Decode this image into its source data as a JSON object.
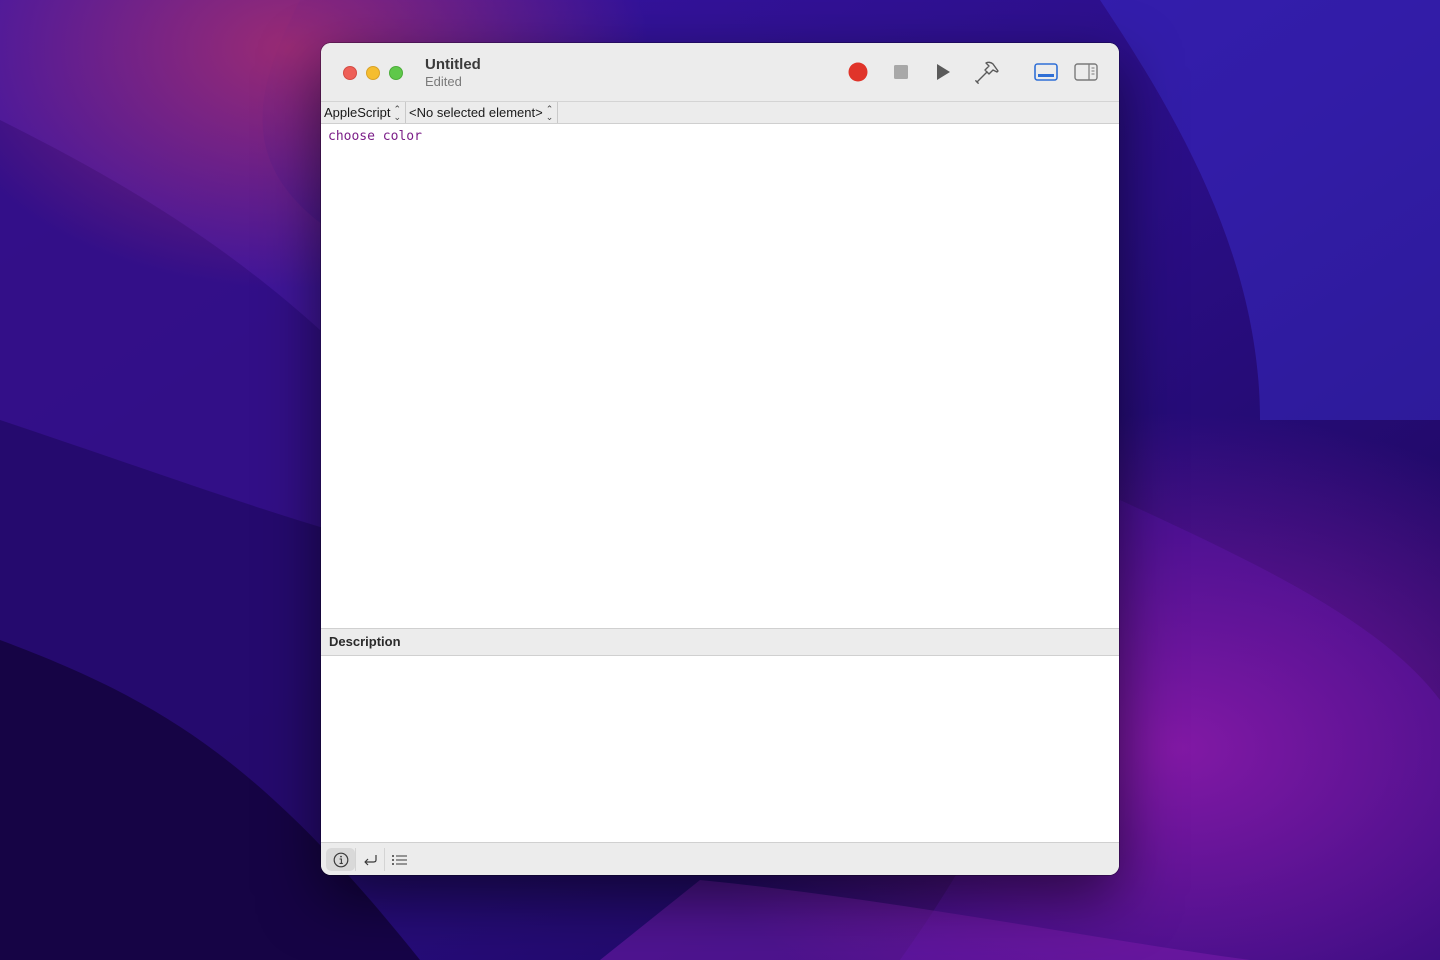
{
  "window": {
    "title": "Untitled",
    "status": "Edited"
  },
  "toolbar": {
    "icons": [
      "record-icon",
      "stop-icon",
      "run-icon",
      "compile-hammer-icon",
      "show-log-icon",
      "show-inspector-icon"
    ],
    "record_color": "#e0342a",
    "accent": "#2f6fd6"
  },
  "navigation": {
    "language_popup": "AppleScript",
    "element_popup": "<No selected element>"
  },
  "editor": {
    "lines": [
      "choose color"
    ],
    "keyword_color": "#7b1e88"
  },
  "description_pane": {
    "header": "Description",
    "content": ""
  },
  "bottom_bar": {
    "icons": [
      "info-icon",
      "reply-arrow-icon",
      "list-icon"
    ],
    "active": "info-icon"
  }
}
